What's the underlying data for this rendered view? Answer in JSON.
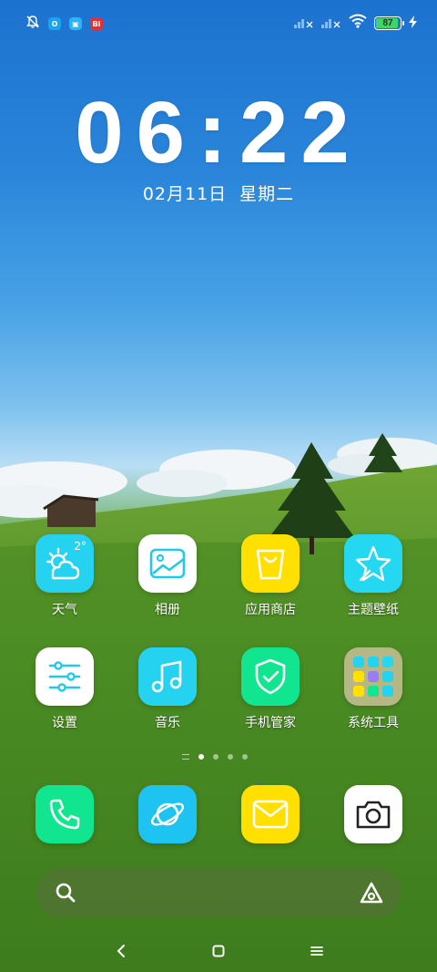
{
  "status_bar": {
    "icons": [
      "mute-icon",
      "app-notification-1",
      "app-notification-2",
      "app-notification-3"
    ],
    "signal_icons": [
      "signal-1-icon",
      "signal-2-icon",
      "wifi-icon"
    ],
    "battery_level": "87",
    "charging": true
  },
  "clock": {
    "time": "06:22",
    "date": "02月11日",
    "weekday": "星期二"
  },
  "weather": {
    "temp": "2°"
  },
  "apps": [
    {
      "label": "天气",
      "icon": "weather-icon",
      "color": "#25d3f0"
    },
    {
      "label": "相册",
      "icon": "gallery-icon",
      "color": "#ffffff"
    },
    {
      "label": "应用商店",
      "icon": "shopping-bag-icon",
      "color": "#ffe000"
    },
    {
      "label": "主题壁纸",
      "icon": "star-icon",
      "color": "#25d8f2"
    },
    {
      "label": "设置",
      "icon": "settings-sliders-icon",
      "color": "#ffffff"
    },
    {
      "label": "音乐",
      "icon": "music-note-icon",
      "color": "#25d3f0"
    },
    {
      "label": "手机管家",
      "icon": "shield-check-icon",
      "color": "#12e58f"
    },
    {
      "label": "系统工具",
      "icon": "folder-icon",
      "color": "#b9b48a"
    }
  ],
  "dock": [
    {
      "name": "phone",
      "icon": "phone-icon",
      "color": "#12e58f"
    },
    {
      "name": "browser",
      "icon": "planet-icon",
      "color": "#1ec3f2"
    },
    {
      "name": "messages",
      "icon": "mail-icon",
      "color": "#ffe000"
    },
    {
      "name": "camera",
      "icon": "camera-icon",
      "color": "#ffffff"
    }
  ],
  "page_indicator": {
    "pages": 4,
    "active": 1
  },
  "search_bar": {
    "icons": [
      "search-icon",
      "assistant-icon"
    ]
  },
  "nav_bar": {
    "icons": [
      "back-icon",
      "home-icon",
      "menu-icon"
    ]
  }
}
